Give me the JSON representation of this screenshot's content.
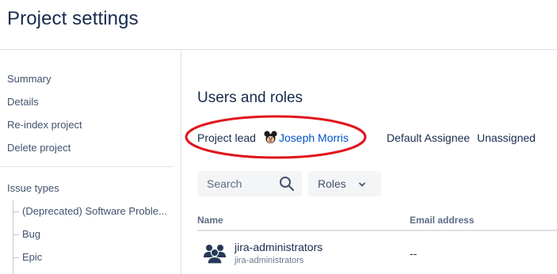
{
  "page": {
    "title": "Project settings"
  },
  "sidebar": {
    "items": [
      {
        "label": "Summary"
      },
      {
        "label": "Details"
      },
      {
        "label": "Re-index project"
      },
      {
        "label": "Delete project"
      }
    ],
    "issue_types": {
      "label": "Issue types",
      "items": [
        {
          "label": "(Deprecated) Software Proble..."
        },
        {
          "label": "Bug"
        },
        {
          "label": "Epic"
        }
      ]
    }
  },
  "main": {
    "section_title": "Users and roles",
    "project_lead": {
      "label": "Project lead",
      "name": "Joseph Morris",
      "avatar_icon": "mickey-avatar-icon"
    },
    "default_assignee": {
      "label": "Default Assignee",
      "value": "Unassigned"
    },
    "search": {
      "placeholder": "Search",
      "icon": "search-icon"
    },
    "roles_filter": {
      "label": "Roles",
      "icon": "chevron-down-icon"
    },
    "table": {
      "columns": [
        "Name",
        "Email address"
      ],
      "rows": [
        {
          "name": "jira-administrators",
          "subtext": "jira-administrators",
          "email": "--",
          "icon": "group-icon"
        }
      ]
    }
  },
  "annotation": {
    "color": "#e0141e",
    "shape": "ellipse"
  },
  "colors": {
    "link": "#0052cc",
    "text": "#172b4d",
    "muted": "#5e6c84",
    "divider": "#dfe1e6"
  }
}
